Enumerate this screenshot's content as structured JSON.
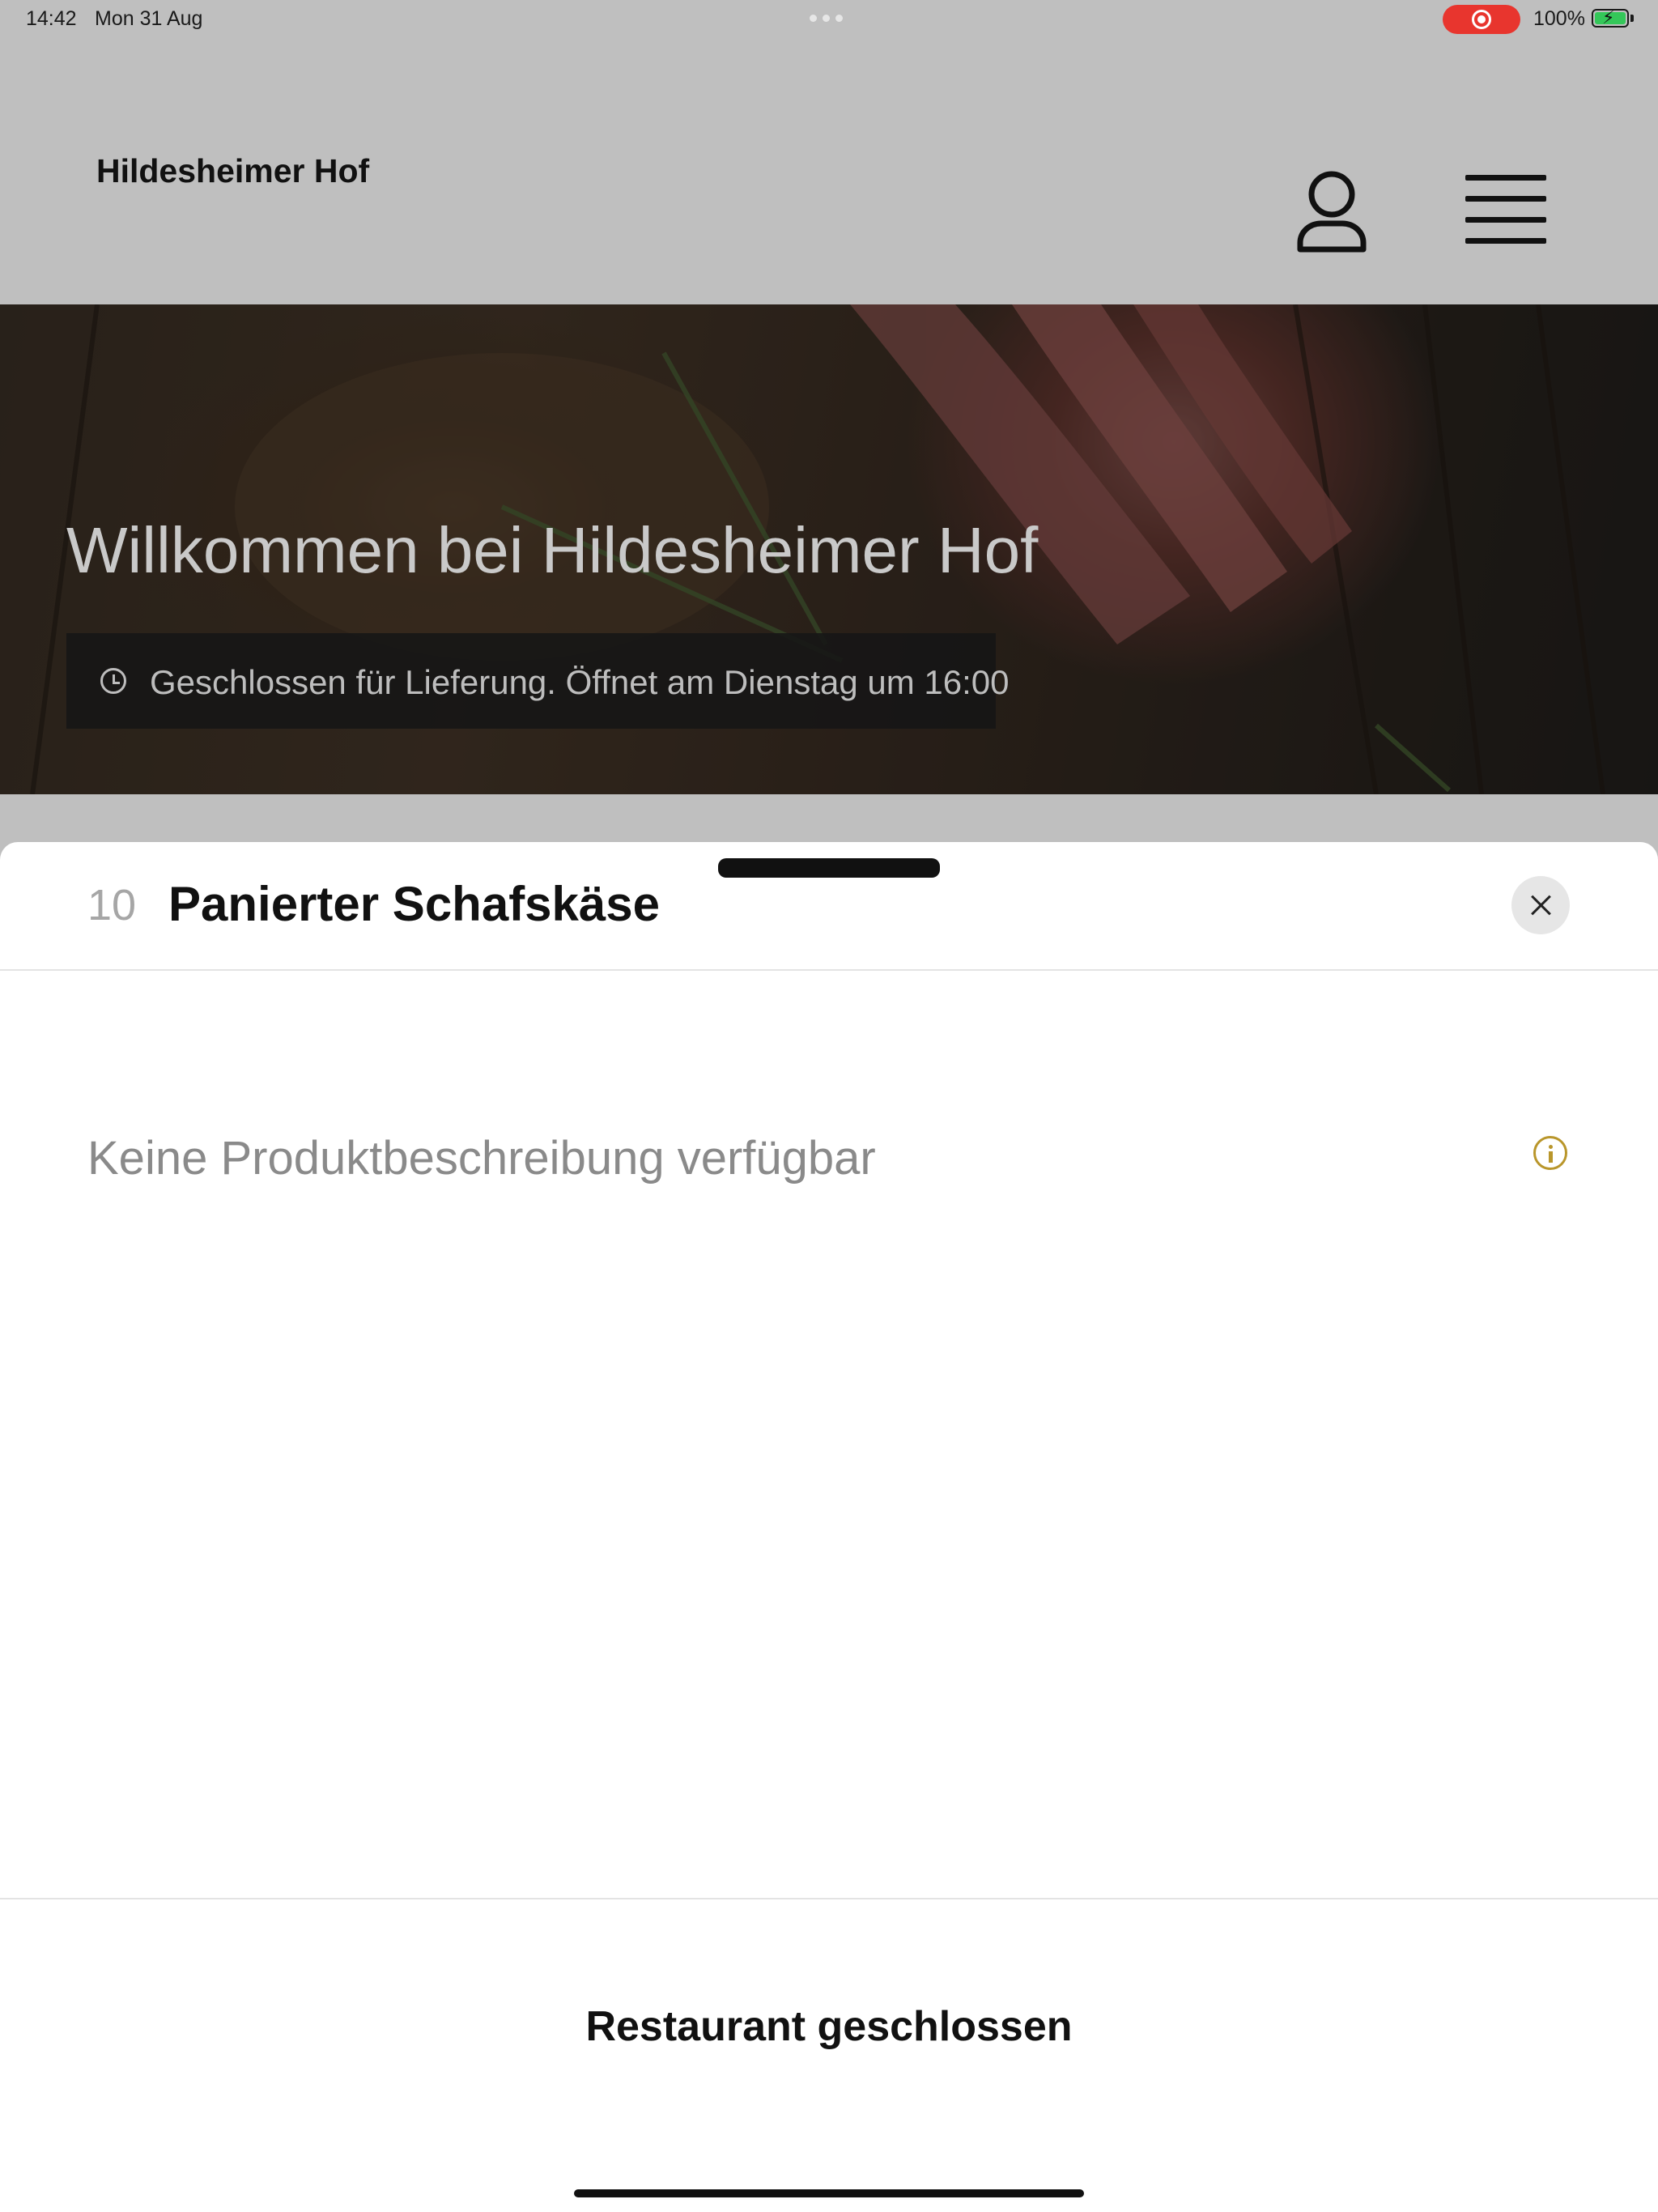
{
  "status_bar": {
    "time": "14:42",
    "date": "Mon 31 Aug",
    "battery_percent": "100%",
    "battery_level": 1.0,
    "screen_recording": true,
    "record_color": "#e8352e",
    "battery_color": "#34c759"
  },
  "header": {
    "app_title": "Hildesheimer Hof",
    "profile_icon": "person-icon",
    "menu_icon": "hamburger-menu-icon"
  },
  "hero": {
    "title": "Willkommen bei Hildesheimer Hof",
    "status_text": "Geschlossen für Lieferung. Öffnet am Dienstag um 16:00",
    "status_icon": "clock-icon"
  },
  "product_sheet": {
    "item_number": "10",
    "item_title": "Panierter Schafskäse",
    "description": "Keine Produktbeschreibung verfügbar",
    "info_icon": "info-icon",
    "info_color": "#b9962b",
    "close_icon": "close-icon",
    "footer_label": "Restaurant geschlossen"
  }
}
